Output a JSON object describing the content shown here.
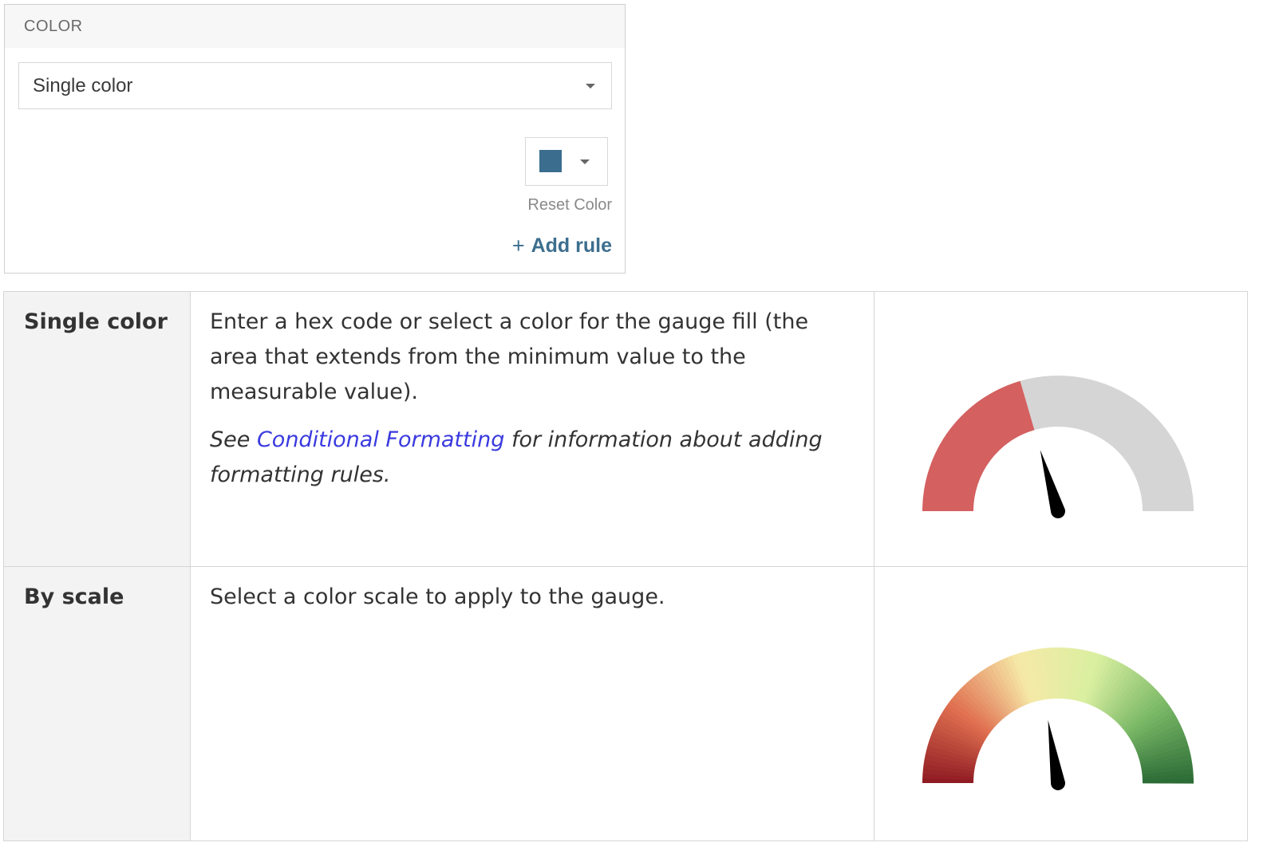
{
  "panel": {
    "header": "COLOR",
    "select_value": "Single color",
    "swatch_color": "#3b6d8e",
    "reset_label": "Reset Color",
    "add_rule_icon": "+",
    "add_rule_label": "Add rule"
  },
  "rows": [
    {
      "name": "Single color",
      "desc": "Enter a hex code or select a color for the gauge fill (the area that extends from the minimum value to the measurable value).",
      "note_prefix": "See ",
      "note_link": "Conditional Formatting",
      "note_suffix": " for information about adding formatting rules.",
      "gauge": {
        "style": "single",
        "fill_color": "#d46060",
        "track_color": "#d5d5d5",
        "needle_color": "#000000",
        "value_fraction": 0.41
      }
    },
    {
      "name": "By scale",
      "desc": "Select a color scale to apply to the gauge.",
      "gauge": {
        "style": "scale",
        "scale_colors": [
          "#8e1a22",
          "#e07050",
          "#f6e9a8",
          "#d9efa0",
          "#7ab866",
          "#2a6a35"
        ],
        "needle_color": "#000000",
        "value_fraction": 0.45
      }
    }
  ]
}
